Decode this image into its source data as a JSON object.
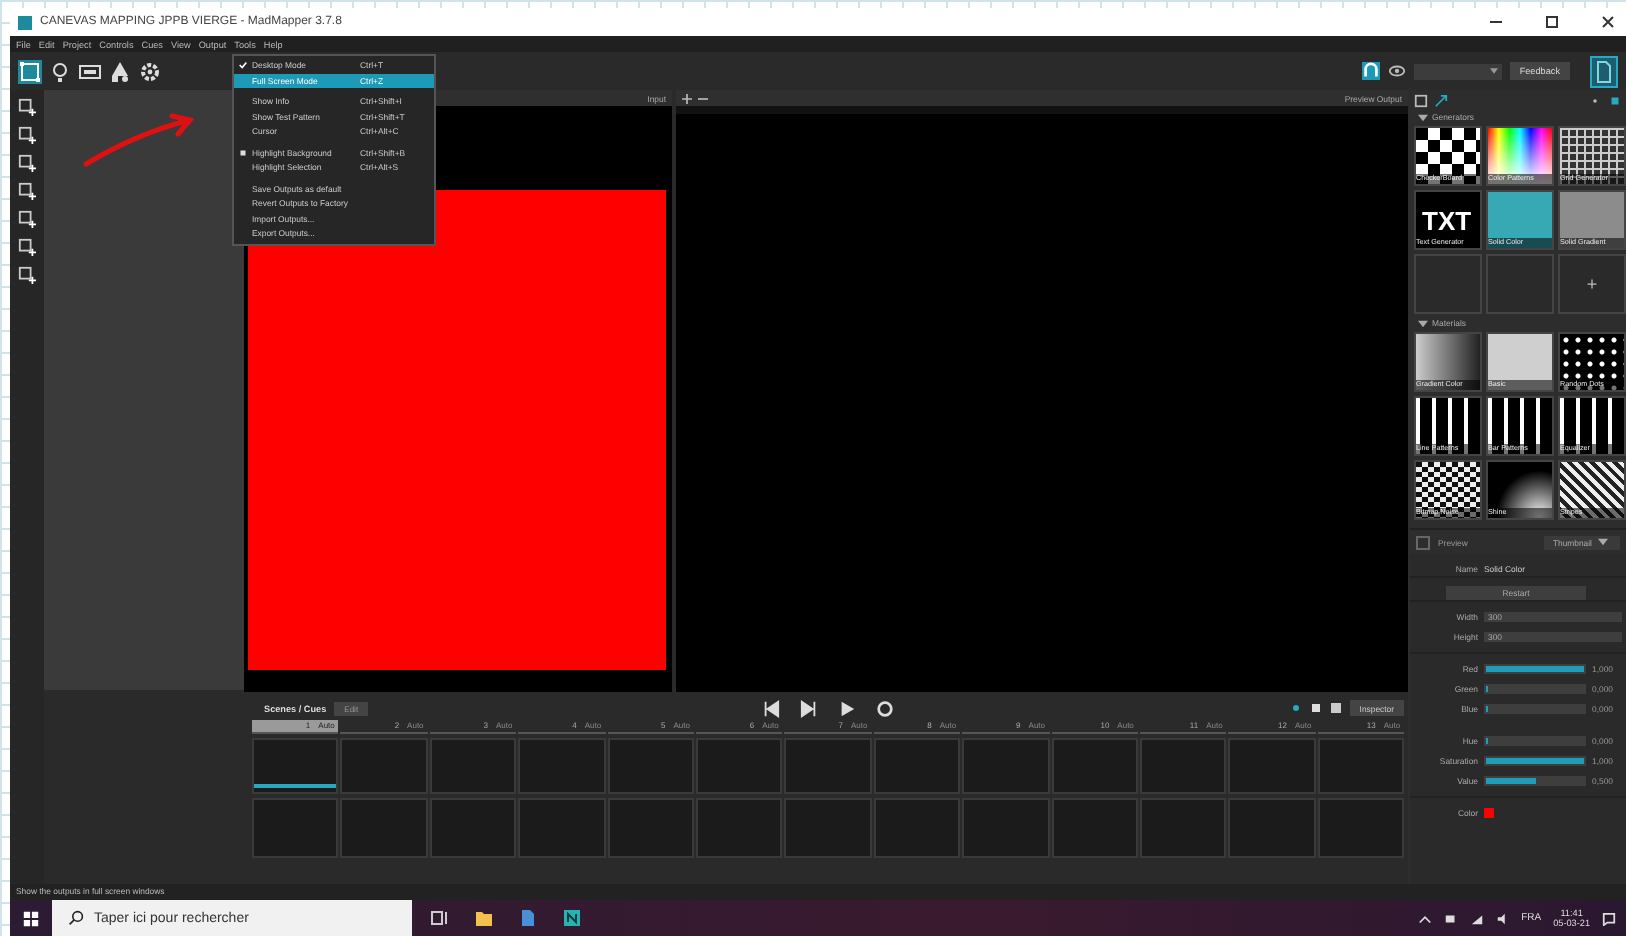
{
  "window": {
    "title": "CANEVAS MAPPING JPPB VIERGE - MadMapper 3.7.8"
  },
  "menu_bar": [
    "File",
    "Edit",
    "Project",
    "Controls",
    "Cues",
    "View",
    "Output",
    "Tools",
    "Help"
  ],
  "output_menu": [
    {
      "label": "Desktop Mode",
      "shortcut": "Ctrl+T",
      "checked": true,
      "bullet": false,
      "selected": false
    },
    {
      "label": "Full Screen Mode",
      "shortcut": "Ctrl+Z",
      "checked": false,
      "bullet": false,
      "selected": true
    },
    {
      "label": "Show Info",
      "shortcut": "Ctrl+Shift+I",
      "checked": false,
      "bullet": false,
      "selected": false
    },
    {
      "label": "Show Test Pattern",
      "shortcut": "Ctrl+Shift+T",
      "checked": false,
      "bullet": false,
      "selected": false
    },
    {
      "label": "Cursor",
      "shortcut": "Ctrl+Alt+C",
      "checked": false,
      "bullet": false,
      "selected": false
    },
    {
      "label": "Highlight Background",
      "shortcut": "Ctrl+Shift+B",
      "checked": false,
      "bullet": true,
      "selected": false
    },
    {
      "label": "Highlight Selection",
      "shortcut": "Ctrl+Alt+S",
      "checked": false,
      "bullet": false,
      "selected": false
    },
    {
      "label": "Save Outputs as default",
      "checked": false,
      "bullet": false,
      "selected": false
    },
    {
      "label": "Revert Outputs to Factory",
      "checked": false,
      "bullet": false,
      "selected": false
    },
    {
      "label": "Import Outputs...",
      "checked": false,
      "bullet": false,
      "selected": false
    },
    {
      "label": "Export Outputs...",
      "checked": false,
      "bullet": false,
      "selected": false
    }
  ],
  "toolbar": {
    "feedback_button": "Feedback"
  },
  "input_view": {
    "label": "Input"
  },
  "output_view": {
    "label": "Preview Output"
  },
  "generators": {
    "title": "Generators",
    "tiles": [
      {
        "kind": "checker",
        "label": "CheckerBoard"
      },
      {
        "kind": "spectrum",
        "label": "Color Patterns"
      },
      {
        "kind": "grid",
        "label": "Grid Generator"
      },
      {
        "kind": "txt",
        "label": "Text Generator",
        "thumb_text": "TXT"
      },
      {
        "kind": "teal",
        "label": "Solid Color"
      },
      {
        "kind": "gray",
        "label": "Solid Gradient"
      }
    ],
    "add_button": "+"
  },
  "materials": {
    "title": "Materials",
    "tiles": [
      {
        "kind": "fade",
        "label": "Gradient Color"
      },
      {
        "kind": "light",
        "label": "Basic"
      },
      {
        "kind": "dots",
        "label": "Random Dots"
      },
      {
        "kind": "bars",
        "label": "Line Patterns"
      },
      {
        "kind": "bars",
        "label": "Bar Patterns"
      },
      {
        "kind": "bars",
        "label": "Equalizer"
      },
      {
        "kind": "noise",
        "label": "Bitmap Noise"
      },
      {
        "kind": "shine",
        "label": "Shine"
      },
      {
        "kind": "stripes",
        "label": "Stripes"
      }
    ]
  },
  "preview": {
    "label": "Preview",
    "checked": false,
    "mode": "Thumbnail"
  },
  "inspector": {
    "name_label": "Name",
    "name": "Solid Color",
    "restart_button": "Restart",
    "sizes": [
      {
        "label": "Width",
        "value": "300"
      },
      {
        "label": "Height",
        "value": "300"
      }
    ],
    "sliders": [
      {
        "label": "Red",
        "level": 1,
        "reading": "1,000"
      },
      {
        "label": "Green",
        "level": 0,
        "reading": "0,000"
      },
      {
        "label": "Blue",
        "level": 0,
        "reading": "0,000"
      },
      {
        "label": "Hue",
        "level": 0,
        "reading": "0,000"
      },
      {
        "label": "Saturation",
        "level": 1,
        "reading": "1,000"
      },
      {
        "label": "Value",
        "level": 0.5,
        "reading": "0,500"
      }
    ],
    "color_label": "Color",
    "color": "#ff0000"
  },
  "cues": {
    "title": "Scenes / Cues",
    "edit_button": "Edit",
    "inspector_button": "Inspector",
    "columns": [
      {
        "number": "1",
        "mode": "Auto",
        "selected": true
      },
      {
        "number": "2",
        "mode": "Auto",
        "selected": false
      },
      {
        "number": "3",
        "mode": "Auto",
        "selected": false
      },
      {
        "number": "4",
        "mode": "Auto",
        "selected": false
      },
      {
        "number": "5",
        "mode": "Auto",
        "selected": false
      },
      {
        "number": "6",
        "mode": "Auto",
        "selected": false
      },
      {
        "number": "7",
        "mode": "Auto",
        "selected": false
      },
      {
        "number": "8",
        "mode": "Auto",
        "selected": false
      },
      {
        "number": "9",
        "mode": "Auto",
        "selected": false
      },
      {
        "number": "10",
        "mode": "Auto",
        "selected": false
      },
      {
        "number": "11",
        "mode": "Auto",
        "selected": false
      },
      {
        "number": "12",
        "mode": "Auto",
        "selected": false
      },
      {
        "number": "13",
        "mode": "Auto",
        "selected": false
      }
    ]
  },
  "status_bar": "Show the outputs in full screen windows",
  "taskbar": {
    "search_placeholder": "Taper ici pour rechercher",
    "language": "FRA",
    "time": "11:41",
    "date": "05-03-21"
  }
}
